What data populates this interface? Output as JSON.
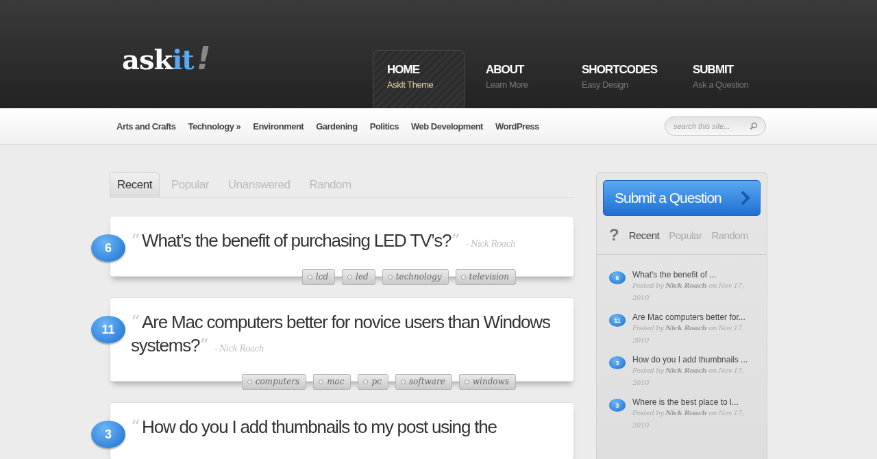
{
  "logo": {
    "text": "ask",
    "accent": "it",
    "mark": "!"
  },
  "main_nav": [
    {
      "title": "HOME",
      "subtitle": "AskIt Theme",
      "selected": true
    },
    {
      "title": "ABOUT",
      "subtitle": "Learn More",
      "selected": false
    },
    {
      "title": "SHORTCODES",
      "subtitle": "Easy Design",
      "selected": false
    },
    {
      "title": "SUBMIT",
      "subtitle": "Ask a Question",
      "selected": false
    }
  ],
  "categories": [
    "Arts and Crafts",
    "Technology »",
    "Environment",
    "Gardening",
    "Politics",
    "Web Development",
    "WordPress"
  ],
  "search": {
    "placeholder": "search this site..."
  },
  "tabs": [
    {
      "label": "Recent",
      "selected": true
    },
    {
      "label": "Popular",
      "selected": false
    },
    {
      "label": "Unanswered",
      "selected": false
    },
    {
      "label": "Random",
      "selected": false
    }
  ],
  "questions": [
    {
      "count": "6",
      "open_quote": "“",
      "title": "What’s the benefit of purchasing LED TV’s?",
      "close_quote": "”",
      "author": "- Nick Roach",
      "tags": [
        "lcd",
        "led",
        "technology",
        "television"
      ]
    },
    {
      "count": "11",
      "open_quote": "“",
      "title": "Are Mac computers better for novice users than Windows systems?",
      "close_quote": "”",
      "author": "- Nick Roach",
      "tags": [
        "computers",
        "mac",
        "pc",
        "software",
        "windows"
      ]
    },
    {
      "count": "3",
      "open_quote": "“",
      "title": "How do you I add thumbnails to my post using the"
    }
  ],
  "sidebar": {
    "submit_button": "Submit a Question",
    "question_mark": "?",
    "tabs": [
      {
        "label": "Recent",
        "selected": true
      },
      {
        "label": "Popular",
        "selected": false
      },
      {
        "label": "Random",
        "selected": false
      }
    ],
    "recent": [
      {
        "count": "6",
        "title": "What's the benefit of ...",
        "meta": "Posted by **Nick Roach** on Nov 17, 2010"
      },
      {
        "count": "11",
        "title": "Are Mac computers better for...",
        "meta": "Posted by **Nick Roach** on Nov 17, 2010"
      },
      {
        "count": "3",
        "title": "How do you I add thumbnails ...",
        "meta": "Posted by **Nick Roach** on Nov 17, 2010"
      },
      {
        "count": "3",
        "title": "Where is the best place to l...",
        "meta": "Posted by **Nick Roach** on Nov 17, 2010"
      }
    ]
  }
}
